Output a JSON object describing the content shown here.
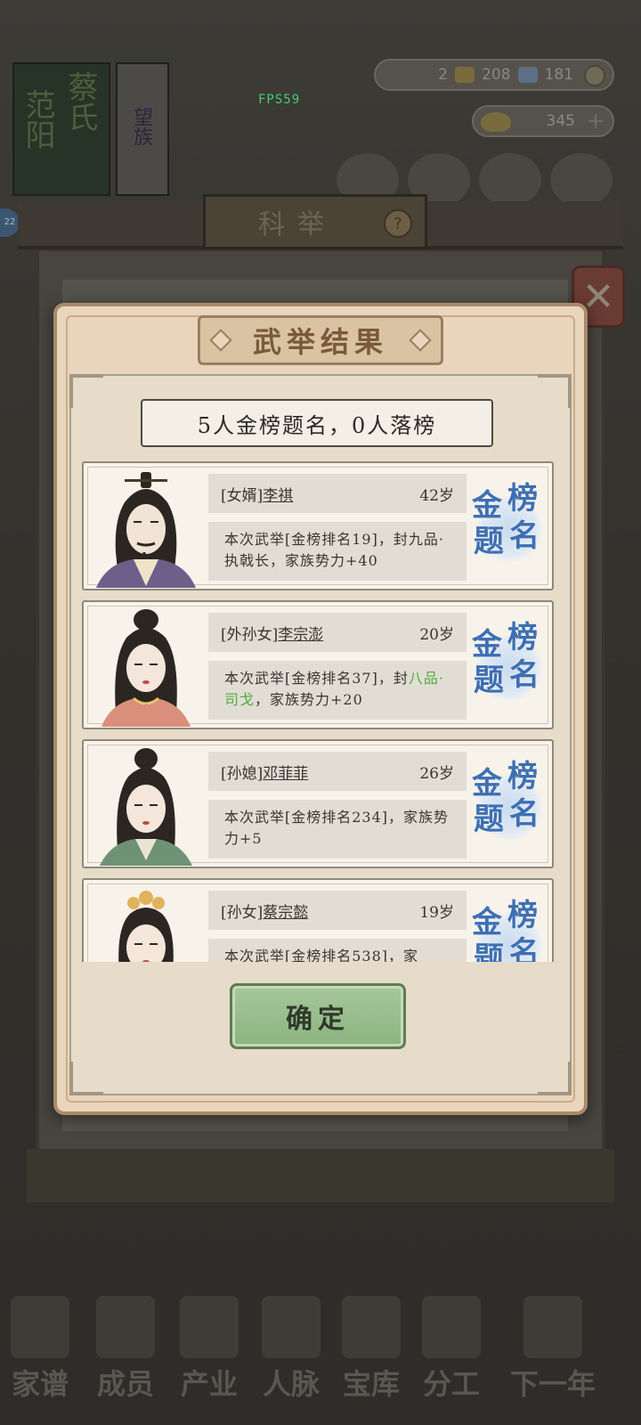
{
  "hud": {
    "fps": "FPS59",
    "res_a": "2",
    "res_b": "208",
    "res_c": "181",
    "gold": "345"
  },
  "background": {
    "book_title_a": "范阳",
    "book_title_b": "蔡氏",
    "book_title_c": "望族",
    "level": "22",
    "exam_title": "科举"
  },
  "dialog": {
    "title": "武举结果",
    "summary": "5人金榜题名，0人落榜",
    "confirm_label": "确定",
    "stamp_chars": [
      "金",
      "榜",
      "题",
      "名"
    ],
    "results": [
      {
        "relation": "[女婿]",
        "name": "李祺",
        "age": "42岁",
        "desc_prefix": "本次武举[金榜排名19]，封九品·执戟长，家族势力+40",
        "desc_highlight": "",
        "desc_suffix": ""
      },
      {
        "relation": "[外孙女]",
        "name": "李宗澎",
        "age": "20岁",
        "desc_prefix": "本次武举[金榜排名37]，封",
        "desc_highlight": "八品·司戈",
        "desc_suffix": "，家族势力+20"
      },
      {
        "relation": "[孙媳]",
        "name": "邓菲菲",
        "age": "26岁",
        "desc_prefix": "本次武举[金榜排名234]，家族势力+5",
        "desc_highlight": "",
        "desc_suffix": ""
      },
      {
        "relation": "[孙女]",
        "name": "蔡宗懿",
        "age": "19岁",
        "desc_prefix": "本次武举[金榜排名538]，家",
        "desc_highlight": "",
        "desc_suffix": ""
      }
    ]
  },
  "nav": {
    "items": [
      "家谱",
      "成员",
      "产业",
      "人脉",
      "宝库",
      "分工",
      "下一年"
    ]
  },
  "colors": {
    "stamp_blue": "#3d6fb4",
    "highlight_green": "#4cae3e",
    "confirm_green": "#8cb47f"
  }
}
